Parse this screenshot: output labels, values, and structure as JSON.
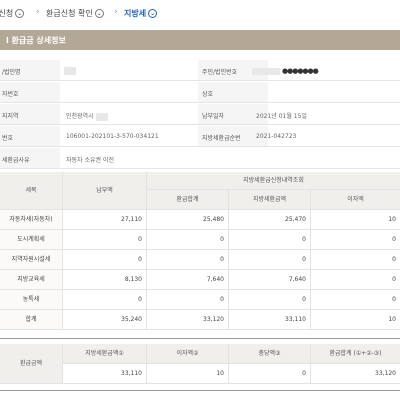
{
  "breadcrumb": {
    "items": [
      {
        "label": "·신청"
      },
      {
        "label": "환급신청 확인"
      },
      {
        "label": "지방세"
      }
    ],
    "icon": "chevron-down-circle-icon"
  },
  "section": {
    "title": "l 환급금 상세정보"
  },
  "info": {
    "name_label": "/법인명",
    "regno_label": "주민/법인번호",
    "regno_dots": "●●●●●●●",
    "biz_label": "자번호",
    "trade_label": "상호",
    "addr_label": "지지역",
    "addr_value": "인천광역시",
    "pay_date_label": "납부일자",
    "pay_date_value": "2021년 01월 15일",
    "elec_label": "번호",
    "elec_value": "106001-202101-3-570-034121",
    "refund_no_label": "지방세환급순번",
    "refund_no_value": "2021-042723",
    "reason_label": "세환급사유",
    "reason_value": "자동차 소유권 이전"
  },
  "table1": {
    "col_tax": "세목",
    "col_paid": "납부액",
    "col_group": "지방세환급신청내역조회",
    "col_total": "환급합계",
    "col_local": "지방세환급액",
    "col_interest": "이자액",
    "rows": [
      {
        "name": "자동차세(자동차)",
        "paid": "27,110",
        "total": "25,480",
        "local": "25,470",
        "interest": "10"
      },
      {
        "name": "도시계획세",
        "paid": "0",
        "total": "0",
        "local": "0",
        "interest": "0"
      },
      {
        "name": "지역자원시설세",
        "paid": "0",
        "total": "0",
        "local": "0",
        "interest": "0"
      },
      {
        "name": "지방교육세",
        "paid": "8,130",
        "total": "7,640",
        "local": "7,640",
        "interest": "0"
      },
      {
        "name": "농특세",
        "paid": "0",
        "total": "0",
        "local": "0",
        "interest": "0"
      },
      {
        "name": "합계",
        "paid": "35,240",
        "total": "33,120",
        "local": "33,110",
        "interest": "10"
      }
    ]
  },
  "table2": {
    "label": "환급금액",
    "headers": [
      "지방세환급액①",
      "이자액②",
      "충당액③",
      "환급합계 (①+②-③)"
    ],
    "values": [
      "33,110",
      "10",
      "0",
      "33,120"
    ]
  },
  "colors": {
    "header_bar": "#b3a795",
    "active_crumb": "#1f63c4"
  }
}
